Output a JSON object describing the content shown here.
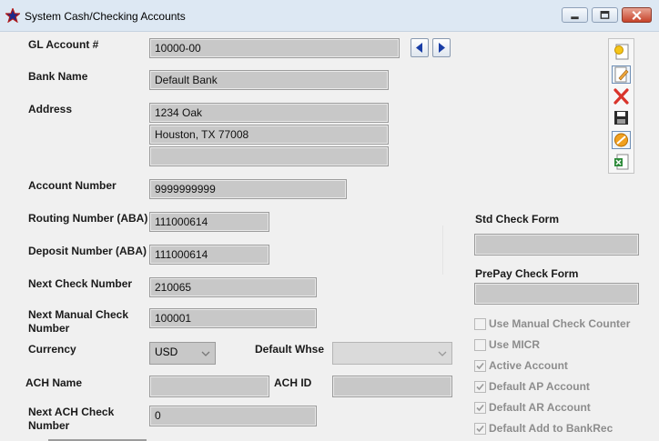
{
  "window": {
    "title": "System Cash/Checking Accounts",
    "controls": [
      "minimize",
      "maximize",
      "close"
    ]
  },
  "form": {
    "gl_account": {
      "label": "GL Account #",
      "value": "10000-00"
    },
    "bank_name": {
      "label": "Bank Name",
      "value": "Default Bank"
    },
    "address": {
      "label": "Address",
      "line1": "1234 Oak",
      "line2": "Houston, TX 77008",
      "line3": ""
    },
    "account_number": {
      "label": "Account Number",
      "value": "9999999999"
    },
    "routing_number": {
      "label": "Routing Number (ABA)",
      "value": "111000614"
    },
    "deposit_number": {
      "label": "Deposit Number (ABA)",
      "value": "111000614"
    },
    "next_check_number": {
      "label": "Next Check Number",
      "value": "210065"
    },
    "next_manual_check_number": {
      "label": "Next Manual Check Number",
      "value": "100001"
    },
    "currency": {
      "label": "Currency",
      "value": "USD"
    },
    "default_whse": {
      "label": "Default Whse",
      "value": ""
    },
    "ach_name": {
      "label": "ACH Name",
      "value": ""
    },
    "ach_id": {
      "label": "ACH ID",
      "value": ""
    },
    "next_ach_check_number": {
      "label": "Next ACH Check Number",
      "value": "0"
    }
  },
  "right_panel": {
    "std_check_form": {
      "label": "Std Check Form",
      "value": ""
    },
    "prepay_check_form": {
      "label": "PrePay Check Form",
      "value": ""
    },
    "checkboxes": [
      {
        "label": "Use Manual Check Counter",
        "checked": false
      },
      {
        "label": "Use MICR",
        "checked": false
      },
      {
        "label": "Active Account",
        "checked": true
      },
      {
        "label": "Default AP Account",
        "checked": true
      },
      {
        "label": "Default AR Account",
        "checked": true
      },
      {
        "label": "Default Add to BankRec",
        "checked": true
      }
    ]
  },
  "toolbar": {
    "icons": [
      "new-record-icon",
      "edit-icon",
      "delete-icon",
      "save-icon",
      "cancel-icon",
      "export-icon"
    ]
  },
  "colors": {
    "field_bg": "#c8c8c8",
    "titlebar_bg": "#dde8f3",
    "nav_arrow": "#1a3ea6",
    "delete_red": "#d9342b",
    "cancel_orange": "#f0a020"
  }
}
